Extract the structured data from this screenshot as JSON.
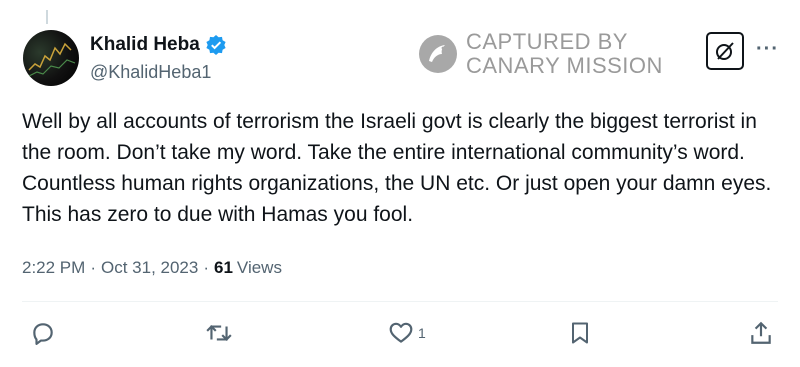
{
  "author": {
    "display_name": "Khalid Heba",
    "handle": "@KhalidHeba1",
    "verified": true
  },
  "watermark": {
    "line1": "CAPTURED BY",
    "line2": "CANARY MISSION"
  },
  "tweet": {
    "text": "Well by all accounts of terrorism the Israeli govt is clearly the biggest terrorist in the room. Don’t take my word. Take the entire international community’s word. Countless human rights organizations, the UN etc. Or just open your damn eyes. This has zero to due with Hamas you fool.",
    "time": "2:22 PM",
    "separator": "·",
    "date": "Oct 31, 2023",
    "views_count": "61",
    "views_label": "Views"
  },
  "actions": {
    "reply": "reply-icon",
    "repost": "repost-icon",
    "like": "heart-icon",
    "like_count": "1",
    "bookmark": "bookmark-icon",
    "share": "share-icon"
  },
  "colors": {
    "text": "#0f1419",
    "secondary": "#536471",
    "verified": "#1d9bf0",
    "watermark": "#9a9a9a"
  }
}
